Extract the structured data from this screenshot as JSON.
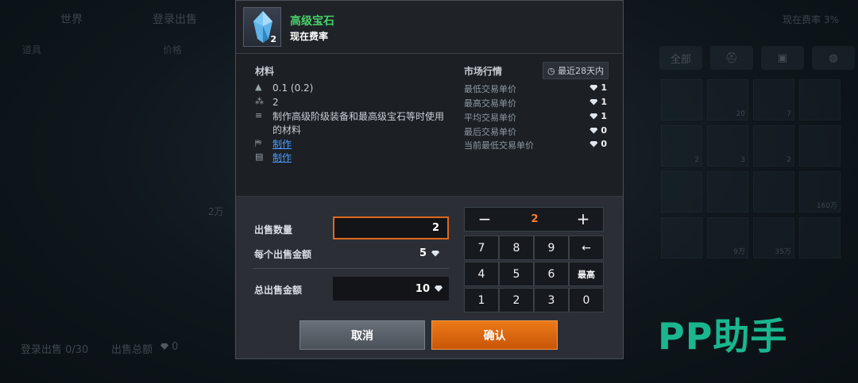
{
  "background": {
    "tabs": [
      "世界",
      "登录出售"
    ],
    "sub_labels": [
      "道具",
      "价格"
    ],
    "fee_rate": "现在费率 3%",
    "filters": [
      "全部"
    ],
    "grid_counts": [
      "",
      "20",
      "7",
      "",
      "2",
      "3",
      "2",
      "",
      "",
      "",
      "",
      "160万",
      "",
      "9万",
      "35万",
      ""
    ],
    "mid_number": "2万",
    "registered": "登录出售 0/30",
    "total_sales": "出售总额",
    "total_sales_value": "0"
  },
  "watermark": "PP助手",
  "modal": {
    "item": {
      "name": "高级宝石",
      "quantity": "2",
      "tag": "现在费率"
    },
    "material": {
      "title": "材料",
      "weight": "0.1 (0.2)",
      "stack": "2",
      "description": "制作高级阶级装备和最高级宝石等时使用的材料",
      "link1": "制作",
      "link2": "制作"
    },
    "market": {
      "title": "市场行情",
      "period": "最近28天内",
      "rows": [
        {
          "label": "最低交易单价",
          "value": "1"
        },
        {
          "label": "最高交易单价",
          "value": "1"
        },
        {
          "label": "平均交易单价",
          "value": "1"
        },
        {
          "label": "最后交易单价",
          "value": "0"
        },
        {
          "label": "当前最低交易单价",
          "value": "0"
        }
      ]
    },
    "sell": {
      "quantity_label": "出售数量",
      "quantity_value": "2",
      "unit_price_label": "每个出售金额",
      "unit_price_value": "5",
      "total_label": "总出售金额",
      "total_value": "10"
    },
    "stepper": {
      "minus": "−",
      "value": "2",
      "plus": "+"
    },
    "keypad": [
      "7",
      "8",
      "9",
      "←",
      "4",
      "5",
      "6",
      "最高",
      "1",
      "2",
      "3",
      "0"
    ],
    "buttons": {
      "cancel": "取消",
      "confirm": "确认"
    }
  },
  "colors": {
    "accent_orange": "#e0671c",
    "item_green": "#47d06a",
    "link_blue": "#4a9cff",
    "watermark_green": "#1ab68e"
  }
}
